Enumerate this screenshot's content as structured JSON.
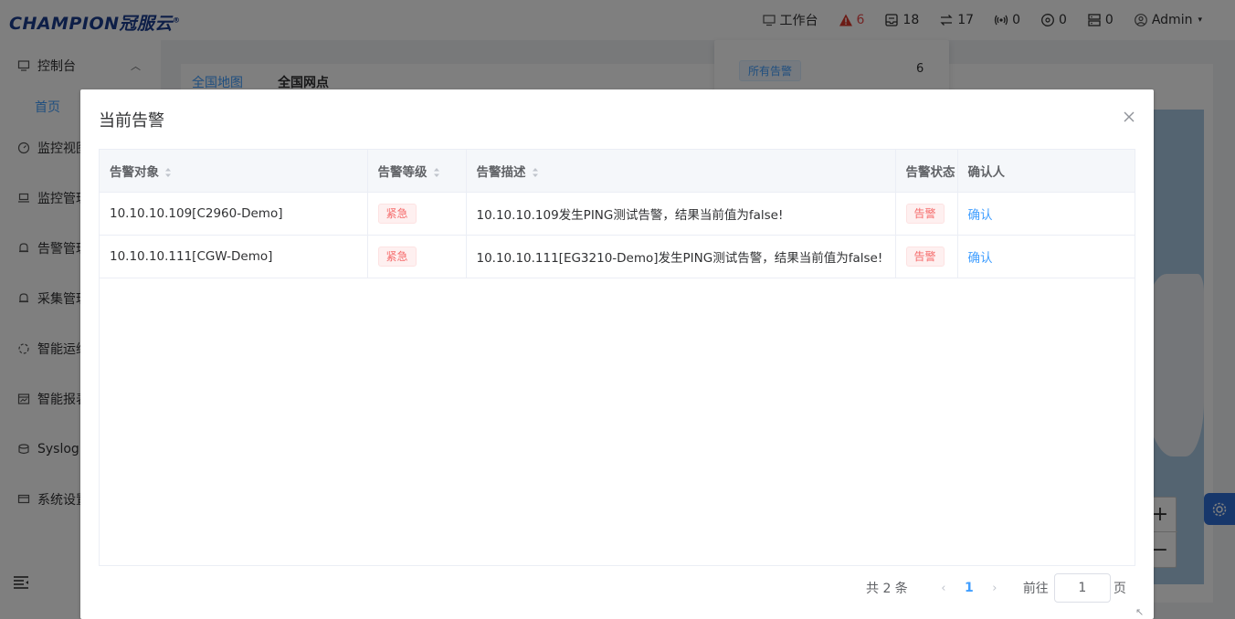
{
  "header": {
    "logo_text": "CHAMPION冠服云",
    "logo_mark": "®",
    "workbench_label": "工作台",
    "alarm_count": "6",
    "item2_count": "18",
    "item3_count": "17",
    "item4_count": "0",
    "item5_count": "0",
    "item6_count": "0",
    "user_label": "Admin"
  },
  "alarm_dropdown": {
    "tag_label": "所有告警",
    "count": "6"
  },
  "sidebar": {
    "items": [
      {
        "label": "控制台"
      },
      {
        "label": "首页"
      },
      {
        "label": "监控视图"
      },
      {
        "label": "监控管理"
      },
      {
        "label": "告警管理"
      },
      {
        "label": "采集管理"
      },
      {
        "label": "智能运维"
      },
      {
        "label": "智能报表"
      },
      {
        "label": "Syslog"
      },
      {
        "label": "系统设置"
      }
    ]
  },
  "main": {
    "tab1": "全国地图",
    "tab2": "全国网点",
    "zoom_in": "+",
    "zoom_out": "−"
  },
  "dialog": {
    "title": "当前告警",
    "columns": [
      "告警对象",
      "告警等级",
      "告警描述",
      "告警状态",
      "确认人"
    ],
    "rows": [
      {
        "object": "10.10.10.109[C2960-Demo]",
        "level": "紧急",
        "description": "10.10.10.109发生PING测试告警，结果当前值为false!",
        "status": "告警",
        "confirm": "确认"
      },
      {
        "object": "10.10.10.111[CGW-Demo]",
        "level": "紧急",
        "description": "10.10.10.111[EG3210-Demo]发生PING测试告警，结果当前值为false!",
        "status": "告警",
        "confirm": "确认"
      }
    ],
    "pager": {
      "total": "共 2 条",
      "prev": "‹",
      "current_page": "1",
      "next": "›",
      "goto_label": "前往",
      "goto_value": "1",
      "page_unit": "页"
    }
  },
  "colors": {
    "primary": "#409eff",
    "danger": "#f56c6c",
    "alarm_red": "#e84b4b",
    "logo_blue": "#1a3d8f"
  }
}
